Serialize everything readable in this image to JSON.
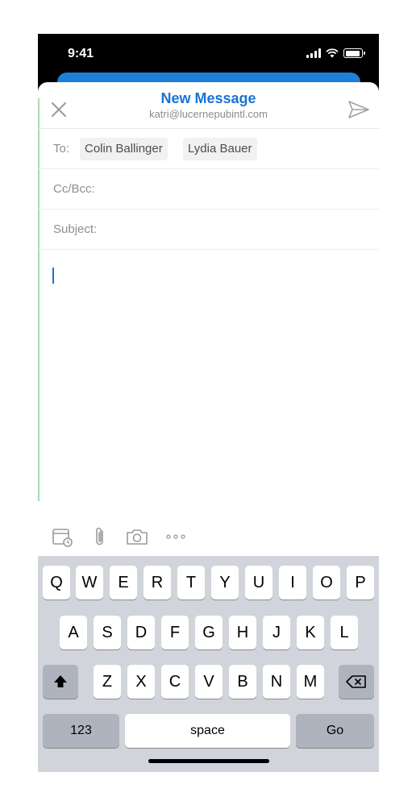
{
  "status_bar": {
    "time": "9:41"
  },
  "header": {
    "title": "New Message",
    "subtitle": "katri@lucernepubintl.com"
  },
  "fields": {
    "to_label": "To:",
    "recipients": [
      "Colin Ballinger",
      "Lydia Bauer"
    ],
    "ccbcc_label": "Cc/Bcc:",
    "subject_label": "Subject:"
  },
  "toolbar": {
    "icons": [
      "calendar-icon",
      "paperclip-icon",
      "camera-icon",
      "more-icon"
    ]
  },
  "keyboard": {
    "row1": [
      "Q",
      "W",
      "E",
      "R",
      "T",
      "Y",
      "U",
      "I",
      "O",
      "P"
    ],
    "row2": [
      "A",
      "S",
      "D",
      "F",
      "G",
      "H",
      "J",
      "K",
      "L"
    ],
    "row3": [
      "Z",
      "X",
      "C",
      "V",
      "B",
      "N",
      "M"
    ],
    "numbers_label": "123",
    "space_label": "space",
    "go_label": "Go"
  },
  "colors": {
    "accent": "#1a73d4",
    "keyboard_bg": "#d1d4db",
    "dark_key": "#aeb3be"
  }
}
